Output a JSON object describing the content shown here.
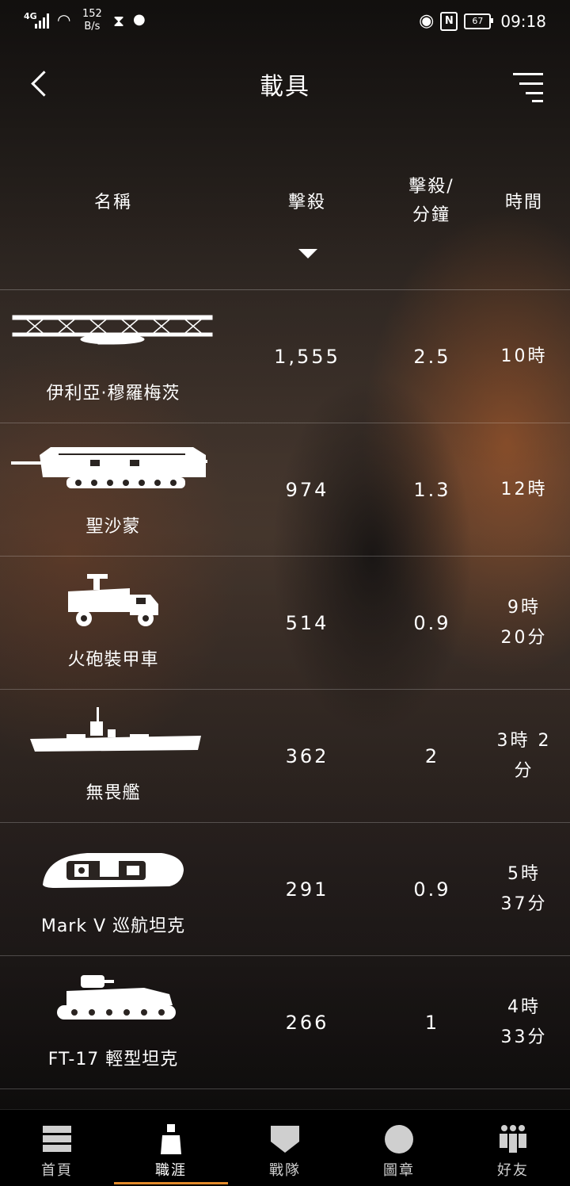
{
  "status_bar": {
    "network": "4G",
    "speed_value": "152",
    "speed_unit": "B/s",
    "battery": "67",
    "time": "09:18"
  },
  "header": {
    "title": "載具"
  },
  "table": {
    "columns": {
      "name": "名稱",
      "kills": "擊殺",
      "kpm": "擊殺/\n分鐘",
      "time": "時間"
    },
    "sort_column": "kills",
    "sort_direction": "descending",
    "rows": [
      {
        "name": "伊利亞·穆羅梅茨",
        "kills": "1,555",
        "kpm": "2.5",
        "time": "10時",
        "icon": "bomber-plane-icon"
      },
      {
        "name": "聖沙蒙",
        "kills": "974",
        "kpm": "1.3",
        "time": "12時",
        "icon": "heavy-tank-icon"
      },
      {
        "name": "火砲裝甲車",
        "kills": "514",
        "kpm": "0.9",
        "time": "9時\n20分",
        "icon": "armored-truck-icon"
      },
      {
        "name": "無畏艦",
        "kills": "362",
        "kpm": "2",
        "time": "3時 2\n分",
        "icon": "battleship-icon"
      },
      {
        "name": "Mark V 巡航坦克",
        "kills": "291",
        "kpm": "0.9",
        "time": "5時\n37分",
        "icon": "landship-tank-icon"
      },
      {
        "name": "FT-17 輕型坦克",
        "kills": "266",
        "kpm": "1",
        "time": "4時\n33分",
        "icon": "light-tank-icon"
      }
    ]
  },
  "bottom_nav": {
    "items": [
      {
        "label": "首頁",
        "icon": "home-icon",
        "active": false
      },
      {
        "label": "職涯",
        "icon": "career-icon",
        "active": true
      },
      {
        "label": "戰隊",
        "icon": "platoon-icon",
        "active": false
      },
      {
        "label": "圖章",
        "icon": "emblem-icon",
        "active": false
      },
      {
        "label": "好友",
        "icon": "friends-icon",
        "active": false
      }
    ]
  },
  "colors": {
    "accent": "#e28a2a",
    "text": "#ffffff",
    "nav_bg": "#000000"
  }
}
